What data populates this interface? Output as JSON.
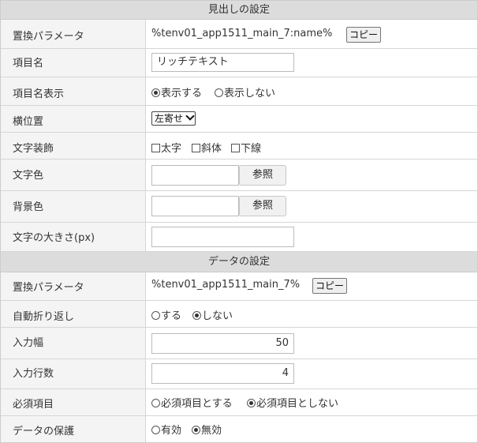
{
  "heading_section": {
    "title": "見出しの設定",
    "param": {
      "label": "置換パラメータ",
      "value": "%tenv01_app1511_main_7:name%",
      "copy_button": "コピー"
    },
    "item_name": {
      "label": "項目名",
      "value": "リッチテキスト"
    },
    "item_display": {
      "label": "項目名表示",
      "options": [
        "表示する",
        "表示しない"
      ],
      "selected": "表示する"
    },
    "align": {
      "label": "横位置",
      "value": "左寄せ"
    },
    "decoration": {
      "label": "文字装飾",
      "options": [
        "太字",
        "斜体",
        "下線"
      ]
    },
    "text_color": {
      "label": "文字色",
      "value": "",
      "button": "参照"
    },
    "bg_color": {
      "label": "背景色",
      "value": "",
      "button": "参照"
    },
    "font_size": {
      "label": "文字の大きさ(px)",
      "value": ""
    }
  },
  "data_section": {
    "title": "データの設定",
    "param": {
      "label": "置換パラメータ",
      "value": "%tenv01_app1511_main_7%",
      "copy_button": "コピー"
    },
    "wrap": {
      "label": "自動折り返し",
      "options": [
        "する",
        "しない"
      ],
      "selected": "しない"
    },
    "input_width": {
      "label": "入力幅",
      "value": "50"
    },
    "input_rows": {
      "label": "入力行数",
      "value": "4"
    },
    "required": {
      "label": "必須項目",
      "options": [
        "必須項目とする",
        "必須項目としない"
      ],
      "selected": "必須項目としない"
    },
    "protect": {
      "label": "データの保護",
      "options": [
        "有効",
        "無効"
      ],
      "selected": "無効"
    }
  }
}
